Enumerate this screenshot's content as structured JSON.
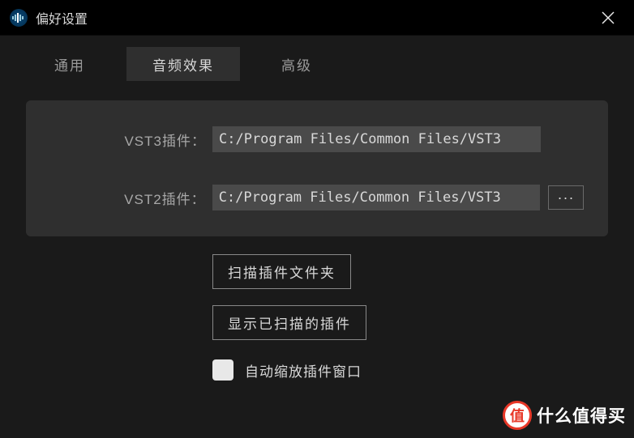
{
  "window": {
    "title": "偏好设置"
  },
  "tabs": [
    {
      "label": "通用",
      "active": false
    },
    {
      "label": "音频效果",
      "active": true
    },
    {
      "label": "高级",
      "active": false
    }
  ],
  "fields": {
    "vst3": {
      "label": "VST3插件：",
      "value": "C:/Program Files/Common Files/VST3"
    },
    "vst2": {
      "label": "VST2插件：",
      "value": "C:/Program Files/Common Files/VST3",
      "browse": "···"
    }
  },
  "actions": {
    "scan_folder": "扫描插件文件夹",
    "show_scanned": "显示已扫描的插件"
  },
  "checkbox": {
    "auto_scale_label": "自动缩放插件窗口",
    "auto_scale_checked": false
  },
  "watermark": {
    "badge": "值",
    "text": "什么值得买"
  }
}
